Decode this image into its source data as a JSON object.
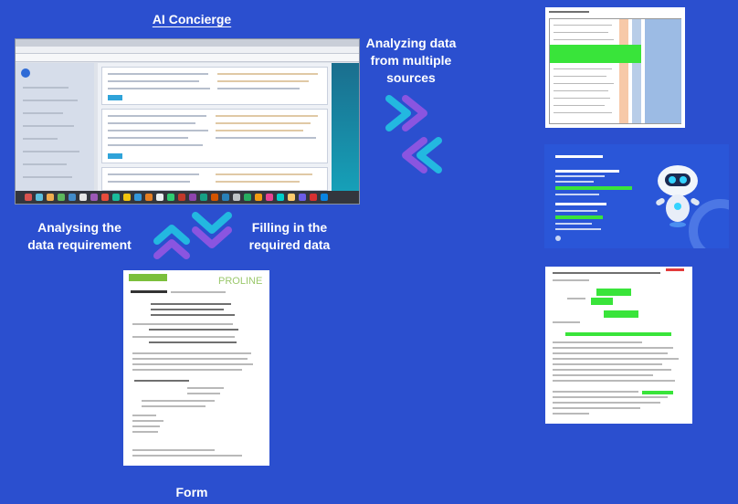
{
  "diagram": {
    "title": "AI Concierge",
    "labels": {
      "analyzing": "Analyzing data from multiple sources",
      "requirement": "Analysing the data requirement",
      "filling": "Filling in the required data",
      "form": "Form"
    }
  },
  "documents": {
    "form_logo": "PROLINE"
  },
  "colors": {
    "background": "#2b4fcf",
    "arrow_cyan": "#23b8e0",
    "arrow_purple": "#8a55e0",
    "highlight_green": "#39e43a"
  }
}
